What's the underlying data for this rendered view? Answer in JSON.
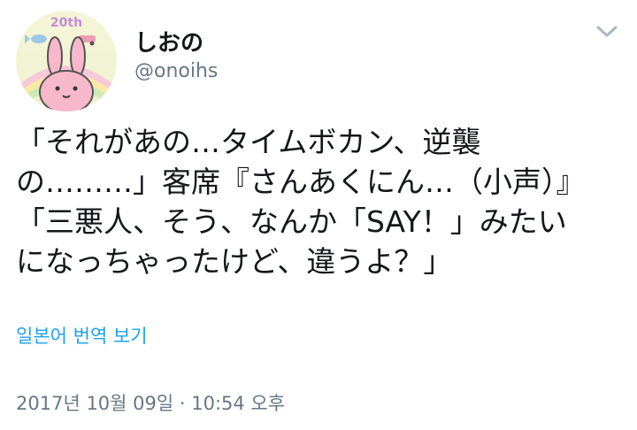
{
  "user": {
    "display_name": "しおの",
    "handle": "@onoihs",
    "avatar_badge": "20th",
    "avatar_icon": "rabbit-avatar"
  },
  "menu": {
    "icon": "chevron-down-icon"
  },
  "tweet": {
    "lines": [
      "「それがあの…タイムボカン、逆襲",
      "の………」客席『さんあくにん…（小声）』",
      "「三悪人、そう、なんか「SAY！」みたい",
      "になっちゃったけど、違うよ？」"
    ]
  },
  "translate_link": "일본어 번역 보기",
  "timestamp": "2017년 10월 09일 · 10:54 오후",
  "colors": {
    "link": "#1da1f2",
    "secondary_text": "#657786",
    "primary_text": "#14171a"
  }
}
